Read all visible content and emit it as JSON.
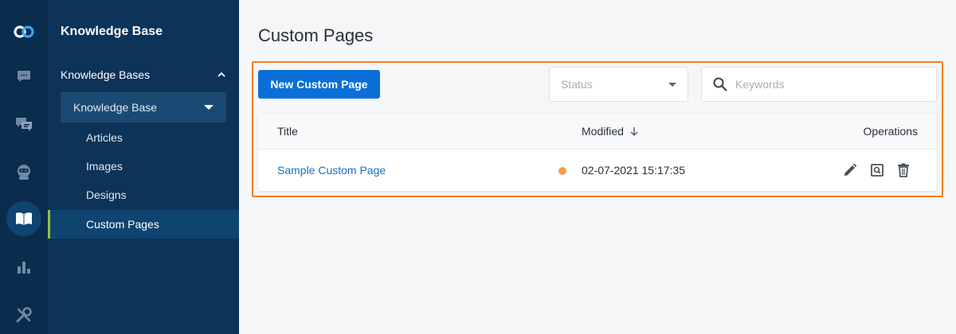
{
  "rail": {
    "icons": [
      "logo-icon",
      "chat-icon",
      "messages-icon",
      "bot-icon",
      "knowledge-base-icon",
      "reports-icon",
      "settings-tools-icon"
    ],
    "active": "knowledge-base-icon"
  },
  "sidebar": {
    "title": "Knowledge Base",
    "section_label": "Knowledge Bases",
    "selected_kb": "Knowledge Base",
    "items": [
      {
        "label": "Articles"
      },
      {
        "label": "Images"
      },
      {
        "label": "Designs"
      },
      {
        "label": "Custom Pages"
      }
    ],
    "active_item": "Custom Pages"
  },
  "main": {
    "page_title": "Custom Pages",
    "new_button_label": "New Custom Page",
    "status_placeholder": "Status",
    "search_placeholder": "Keywords",
    "table": {
      "headers": {
        "title": "Title",
        "modified": "Modified",
        "operations": "Operations"
      },
      "rows": [
        {
          "title": "Sample Custom Page",
          "modified": "02-07-2021 15:17:35",
          "status_color": "#f5a04d"
        }
      ]
    }
  },
  "colors": {
    "accent": "#0a6fd8",
    "highlight_border": "#f07e26",
    "sidebar_bg": "#0d3358",
    "rail_bg": "#0a2c4d",
    "active_indicator": "#8cc63f",
    "link": "#1a6fc2"
  }
}
